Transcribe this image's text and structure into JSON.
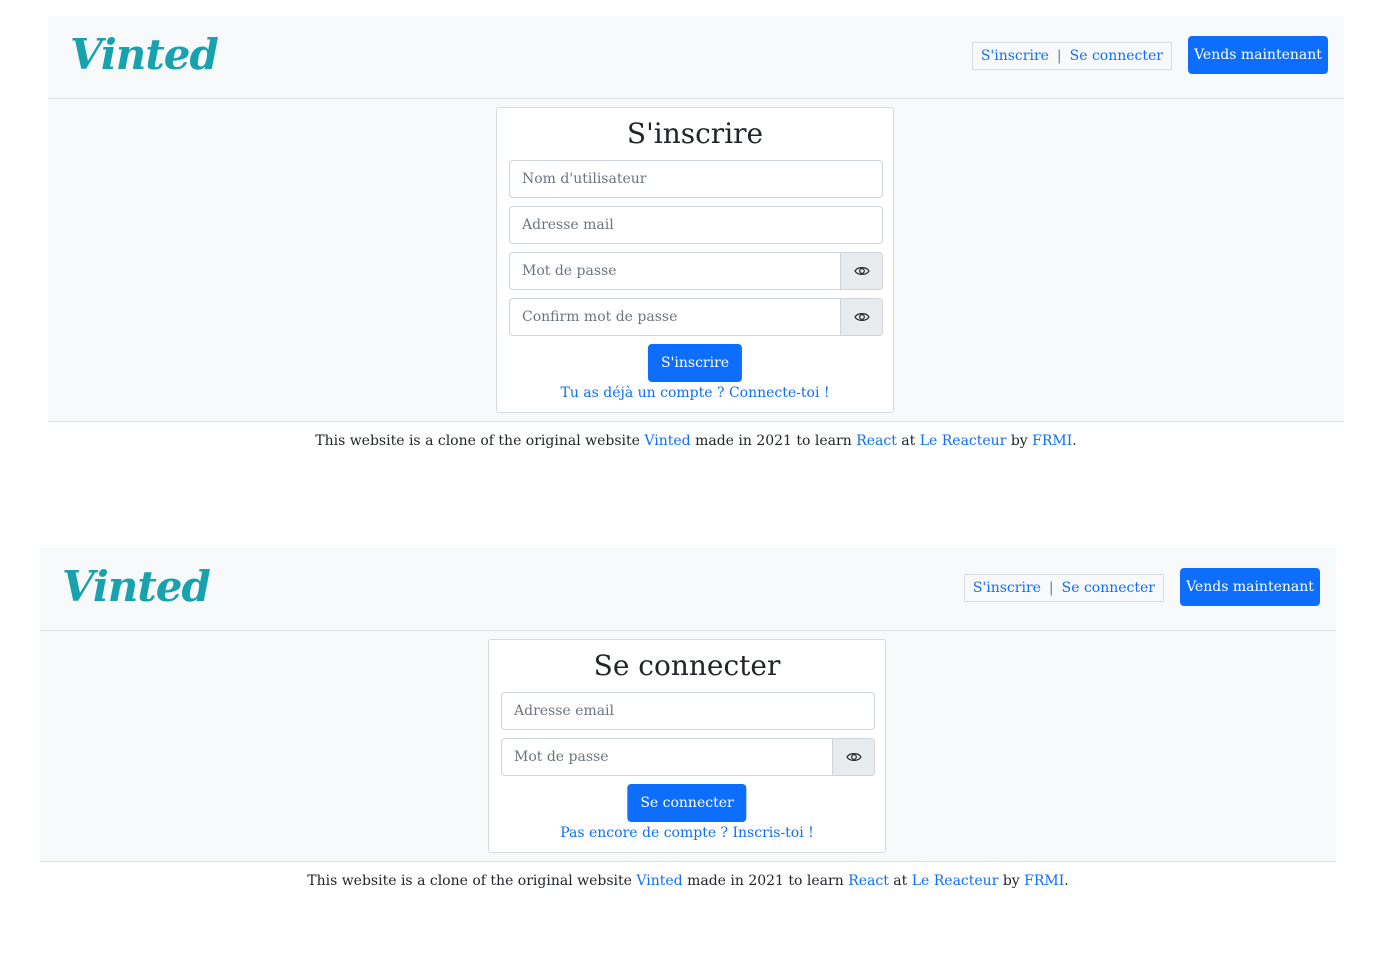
{
  "brand": {
    "logo_text": "Vinted",
    "color": "#17a2ad",
    "accent": "#0d6efd"
  },
  "header": {
    "signup_label": "S'inscrire",
    "separator": "|",
    "login_label": "Se connecter",
    "sell_label": "Vends maintenant"
  },
  "signup": {
    "title": "S'inscrire",
    "username_placeholder": "Nom d'utilisateur",
    "email_placeholder": "Adresse mail",
    "password_placeholder": "Mot de passe",
    "confirm_placeholder": "Confirm mot de passe",
    "submit_label": "S'inscrire",
    "switch_text": "Tu as déjà un compte ? Connecte-toi !",
    "eye_icon": "eye-icon"
  },
  "login": {
    "title": "Se connecter",
    "email_placeholder": "Adresse email",
    "password_placeholder": "Mot de passe",
    "submit_label": "Se connecter",
    "switch_text": "Pas encore de compte ? Inscris-toi !",
    "eye_icon": "eye-icon"
  },
  "footer": {
    "text_1": "This website is a clone of the original website ",
    "link_vinted": "Vinted",
    "text_2": " made in 2021 to learn ",
    "link_react": "React",
    "text_3": " at ",
    "link_lereacteur": "Le Reacteur",
    "text_4": " by ",
    "link_frmi": "FRMI",
    "text_5": "."
  }
}
